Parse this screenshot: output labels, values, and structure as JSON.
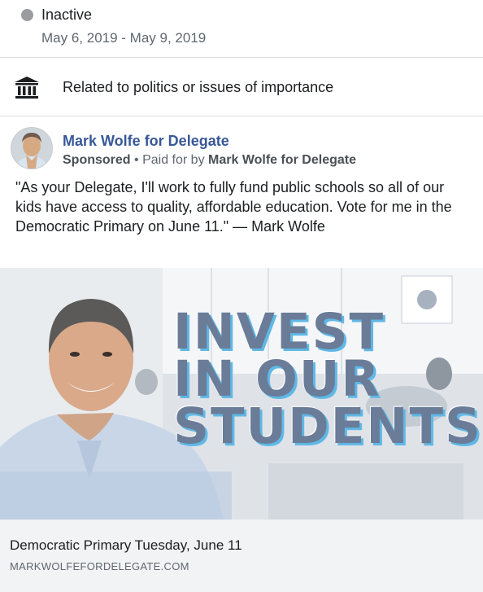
{
  "status": {
    "label": "Inactive",
    "dates": "May 6, 2019 - May 9, 2019",
    "dot_color": "#9a9c9f"
  },
  "category": {
    "icon": "government-building-icon",
    "label": "Related to politics or issues of importance"
  },
  "post": {
    "page_name": "Mark Wolfe for Delegate",
    "sponsored": "Sponsored",
    "separator": "•",
    "paid_for_prefix": "Paid for by",
    "paid_for_name": "Mark Wolfe for Delegate",
    "body": "\"As your Delegate, I'll work to fully fund public schools so all of our kids have access to quality, affordable education. Vote for me in the Democratic Primary on June 11.\" — Mark Wolfe",
    "image": {
      "headline_lines": [
        "INVEST",
        "IN OUR",
        "STUDENTS"
      ],
      "accent_color": "#5fb8e6"
    },
    "link": {
      "headline": "Democratic Primary Tuesday, June 11",
      "domain": "MARKWOLFEFORDELEGATE.COM"
    }
  },
  "colors": {
    "link_blue": "#385898",
    "divider": "#dadde1",
    "footer_bg": "#f2f3f5"
  }
}
